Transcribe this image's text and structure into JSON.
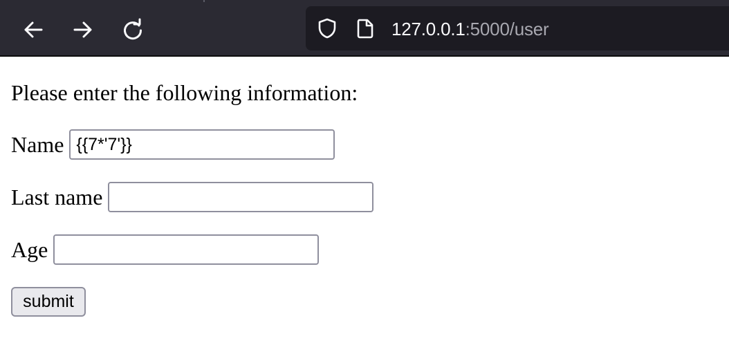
{
  "browser": {
    "url_host": "127.0.0.1",
    "url_rest": ":5000/user",
    "icons": {
      "back": "arrow-left-icon",
      "forward": "arrow-right-icon",
      "reload": "reload-icon",
      "security": "shield-icon",
      "page": "page-icon"
    },
    "colors": {
      "toolbar": "#2b2a33",
      "urlbar": "#1c1b22",
      "url_host_text": "#fbfbfe",
      "url_rest_text": "#a8a8b0"
    }
  },
  "form": {
    "intro": "Please enter the following information:",
    "fields": {
      "name": {
        "label": "Name",
        "value": "{{7*'7'}}"
      },
      "last_name": {
        "label": "Last name",
        "value": ""
      },
      "age": {
        "label": "Age",
        "value": ""
      }
    },
    "submit_label": "submit"
  }
}
